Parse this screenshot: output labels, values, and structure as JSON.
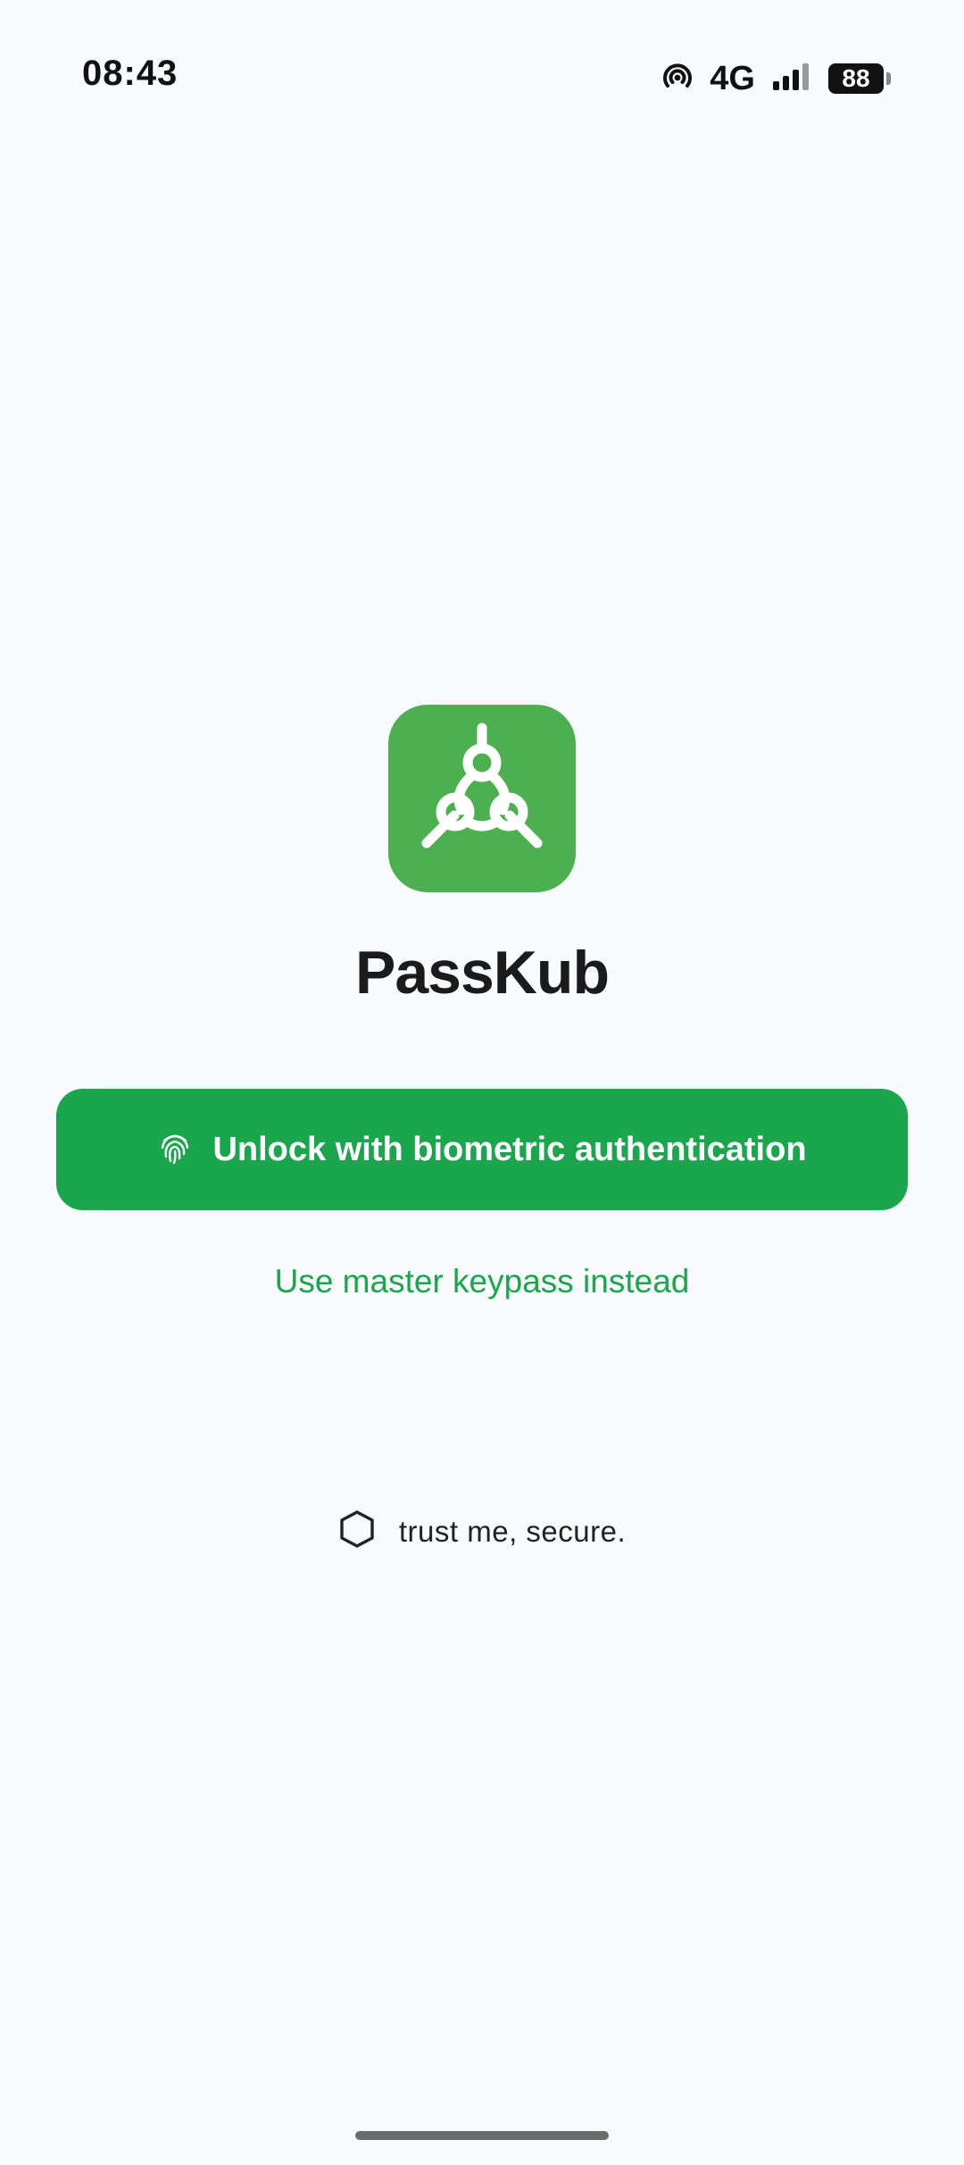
{
  "status_bar": {
    "time": "08:43",
    "network": "4G",
    "battery": "88",
    "icons": [
      "hotspot-icon",
      "signal-icon",
      "battery-icon"
    ]
  },
  "app": {
    "name": "PassKub",
    "icon": "passkub-logo-icon",
    "brand_color": "#4caf50"
  },
  "actions": {
    "unlock_label": "Unlock with biometric authentication",
    "unlock_icon": "fingerprint-icon",
    "unlock_color": "#1aa64c",
    "alt_label": "Use master keypass instead"
  },
  "footer": {
    "trust_text": "trust me, secure.",
    "trust_icon": "shield-icon"
  }
}
